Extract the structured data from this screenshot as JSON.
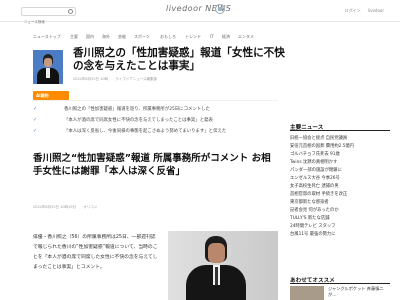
{
  "header": {
    "search_placeholder": "ニュース検索",
    "logo_text": "livedoor NEWS",
    "links": [
      "ログイン",
      "livedoor"
    ]
  },
  "subnav": [
    "ニューストップ",
    "主要",
    "国内",
    "海外",
    "芸能",
    "スポーツ",
    "おもしろ",
    "トレンド",
    "IT",
    "経済",
    "エンタメ"
  ],
  "article": {
    "headline": "香川照之の「性加害疑惑」報道「女性に不快の念を与えたことは事実」",
    "meta": [
      "2022年8月25日 10時",
      "ライブドアニュース編集部"
    ],
    "ai_label": "AI要約",
    "summary": [
      "香川照之の「性加害疑惑」報道を巡り、所属事務所が25日にコメントした",
      "「本人が酒の席で同席女性に不快の念を与えてしまったことは事実」と発表",
      "「本人は深く反省し、今後同様の事態を起こさぬよう努めてまいります」と伝えた"
    ],
    "headline2": "香川照之“性加害疑惑”報道 所属事務所がコメント お相手女性には謝罪「本人は深く反省」",
    "meta2": [
      "2022年8月25日 10時15分",
      "オリコン"
    ],
    "body": "俳優・香川照之（56）の所属事務所は25日、一部週刊誌で報じられた香川の“性加害疑惑”報道について、当時のことを「本人が酒の席で同席した女性に不快の念を与えてしまったことは事実」とコメント。"
  },
  "sidebar": {
    "title": "主要ニュース",
    "ranking": [
      "旧統一協会と接点 自民党議員",
      "安倍元首相の国葬 費用約2.5億円",
      "ゴルバチョフ氏死去 91歳",
      "Twins 沈黙の真相明かす",
      "パンダ一部の施設が閉鎖に",
      "エンゼルス大谷 今季26号",
      "女子高校生死亡 逮捕の男",
      "首相官邸の取材 手続きを改正",
      "東京都新たな感染者",
      "記者会見 何があったのか",
      "TULLY'S 新たな店舗",
      "24時間テレビ スタッフ",
      "台風11号 最強の勢力に"
    ],
    "title2": "あわせてオススメ",
    "rec_text": "ジャングルポケット 斉藤慎二が..."
  }
}
